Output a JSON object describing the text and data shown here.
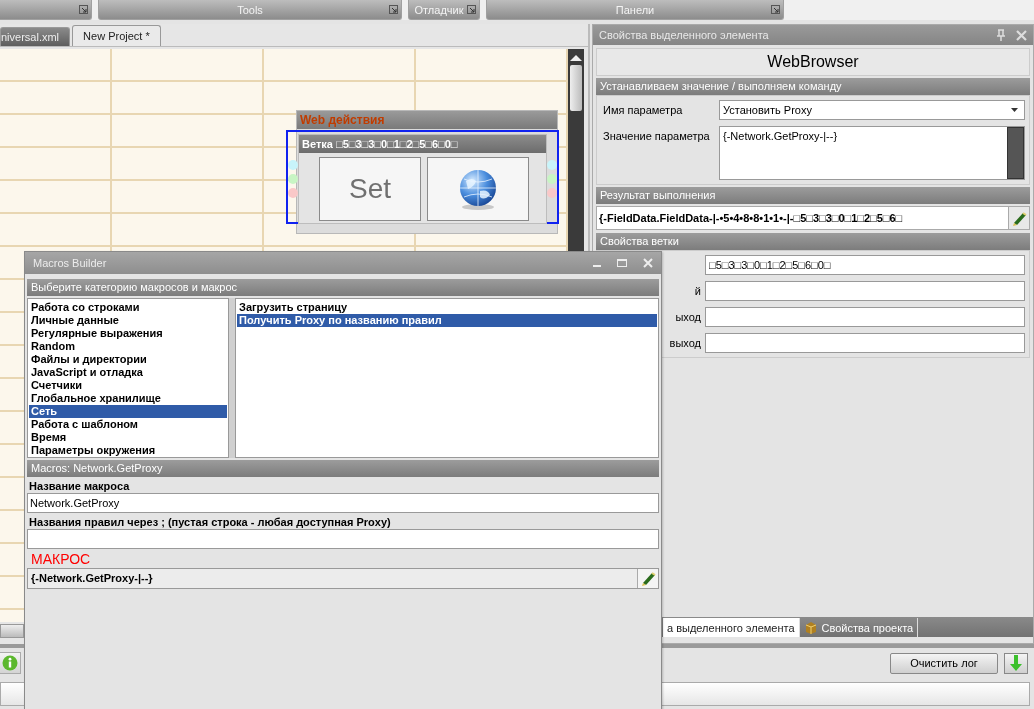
{
  "toolbar": {
    "groups": [
      {
        "label": "Tools"
      },
      {
        "label": "Отладчик"
      },
      {
        "label": "Панели"
      }
    ]
  },
  "document_tabs": [
    {
      "label": "niversal.xml",
      "selected": false
    },
    {
      "label": "New Project *",
      "selected": true
    }
  ],
  "canvas": {
    "group": {
      "title": "Web действия",
      "branch": {
        "title": "Ветка □5□3□3□0□1□2□5□6□0□",
        "selected": true,
        "actions": [
          {
            "kind": "text",
            "label": "Set"
          },
          {
            "kind": "globe"
          }
        ]
      }
    }
  },
  "properties_panel": {
    "title": "Свойства выделенного элемента",
    "element_name": "WebBrowser",
    "command_section": {
      "title": "Устанавливаем значение / выполняем команду",
      "rows": [
        {
          "kind": "select",
          "label": "Имя параметра",
          "value": "Установить Proxy"
        },
        {
          "kind": "textarea",
          "label": "Значение параметра",
          "value": "{-Network.GetProxy-|--}"
        }
      ]
    },
    "result_section": {
      "title": "Результат выполнения",
      "value": "{-FieldData.FieldData-|-•5•4•8•8•1•1•-|-□5□3□3□0□1□2□5□6□"
    },
    "branch_section": {
      "title": "Свойства ветки",
      "rows": [
        {
          "value": "□5□3□3□0□1□2□5□6□0□"
        },
        {
          "label": "й"
        },
        {
          "label": "ыход"
        },
        {
          "label": "выход"
        }
      ]
    },
    "tabs": [
      {
        "label": "а выделенного элемента",
        "selected": true
      },
      {
        "label": "Свойства проекта",
        "selected": false
      }
    ]
  },
  "log": {
    "clear_button": "Очистить лог"
  },
  "macros_builder": {
    "title": "Macros Builder",
    "category_header": "Выберите категорию макросов и макрос",
    "categories": [
      {
        "label": "Работа со строками",
        "selected": false
      },
      {
        "label": "Личные данные",
        "selected": false
      },
      {
        "label": "Регулярные выражения",
        "selected": false
      },
      {
        "label": "Random",
        "selected": false
      },
      {
        "label": "Файлы и директории",
        "selected": false
      },
      {
        "label": "JavaScript и отладка",
        "selected": false
      },
      {
        "label": "Счетчики",
        "selected": false
      },
      {
        "label": "Глобальное хранилище",
        "selected": false
      },
      {
        "label": "Сеть",
        "selected": true
      },
      {
        "label": "Работа с шаблоном",
        "selected": false
      },
      {
        "label": "Время",
        "selected": false
      },
      {
        "label": "Параметры окружения",
        "selected": false
      }
    ],
    "macros": [
      {
        "label": "Загрузить страницу",
        "selected": false
      },
      {
        "label": "Получить Proxy по названию правил",
        "selected": true
      }
    ],
    "macro_header": "Macros: Network.GetProxy",
    "fields": [
      {
        "label": "Название макроса",
        "value": "Network.GetProxy"
      },
      {
        "label": "Названия правил через ; (пустая строка - любая доступная Proxy)"
      }
    ],
    "macro_label": "МАКРОС",
    "macro_value": "{-Network.GetProxy-|--}"
  }
}
